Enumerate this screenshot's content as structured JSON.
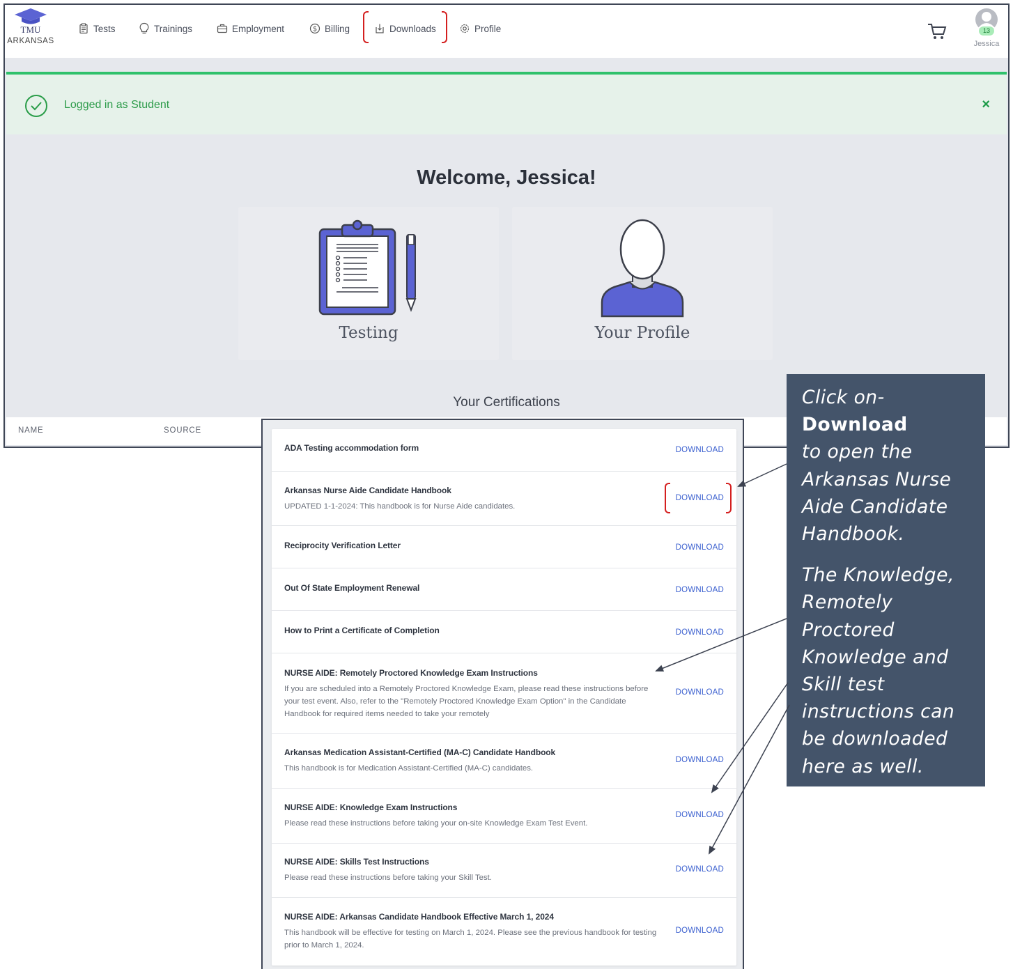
{
  "logo": {
    "line1": "TMU",
    "line2": "ARKANSAS"
  },
  "nav": [
    {
      "label": "Tests",
      "icon": "clipboard-icon"
    },
    {
      "label": "Trainings",
      "icon": "lightbulb-icon"
    },
    {
      "label": "Employment",
      "icon": "briefcase-icon"
    },
    {
      "label": "Billing",
      "icon": "dollar-icon"
    },
    {
      "label": "Downloads",
      "icon": "download-icon"
    },
    {
      "label": "Profile",
      "icon": "gear-icon"
    }
  ],
  "user": {
    "name": "Jessica",
    "badge": "13"
  },
  "alert": {
    "message": "Logged in as Student",
    "close": "×"
  },
  "welcome": "Welcome, Jessica!",
  "cards": {
    "testing": "Testing",
    "profile": "Your Profile"
  },
  "certifications": {
    "heading": "Your Certifications",
    "col_name": "NAME",
    "col_source": "SOURCE"
  },
  "downloads": [
    {
      "title": "ADA Testing accommodation form",
      "desc": "",
      "action": "DOWNLOAD"
    },
    {
      "title": "Arkansas Nurse Aide Candidate Handbook",
      "desc": "UPDATED 1-1-2024: This handbook is for Nurse Aide candidates.",
      "action": "DOWNLOAD"
    },
    {
      "title": "Reciprocity Verification Letter",
      "desc": "",
      "action": "DOWNLOAD"
    },
    {
      "title": "Out Of State Employment Renewal",
      "desc": "",
      "action": "DOWNLOAD"
    },
    {
      "title": "How to Print a Certificate of Completion",
      "desc": "",
      "action": "DOWNLOAD"
    },
    {
      "title": "NURSE AIDE: Remotely Proctored Knowledge Exam Instructions",
      "desc": "If you are scheduled into a Remotely Proctored Knowledge Exam, please read these instructions before your test event. Also, refer to the \"Remotely Proctored Knowledge Exam Option\" in the Candidate Handbook for required items needed to take your remotely",
      "action": "DOWNLOAD"
    },
    {
      "title": "Arkansas Medication Assistant-Certified (MA-C) Candidate Handbook",
      "desc": "This handbook is for Medication Assistant-Certified (MA-C) candidates.",
      "action": "DOWNLOAD"
    },
    {
      "title": "NURSE AIDE: Knowledge Exam Instructions",
      "desc": "Please read these instructions before taking your on-site Knowledge Exam Test Event.",
      "action": "DOWNLOAD"
    },
    {
      "title": "NURSE AIDE: Skills Test Instructions",
      "desc": "Please read these instructions before taking your Skill Test.",
      "action": "DOWNLOAD"
    },
    {
      "title": "NURSE AIDE: Arkansas Candidate Handbook Effective March 1, 2024",
      "desc": "This handbook will be effective for testing on March 1, 2024. Please see the previous handbook for testing prior to March 1, 2024.",
      "action": "DOWNLOAD"
    }
  ],
  "callout": {
    "p1_a": "Click on-",
    "p1_b": "Download",
    "p1_c": "to open the Arkansas Nurse Aide Candidate Handbook.",
    "p2": "The Knowledge, Remotely Proctored Knowledge and Skill test instructions can be downloaded here as well."
  },
  "colors": {
    "accent": "#5b63d3",
    "success": "#2fc16b",
    "link": "#3a5fcf",
    "callout_bg": "#44546a",
    "highlight": "#d41f1f"
  }
}
